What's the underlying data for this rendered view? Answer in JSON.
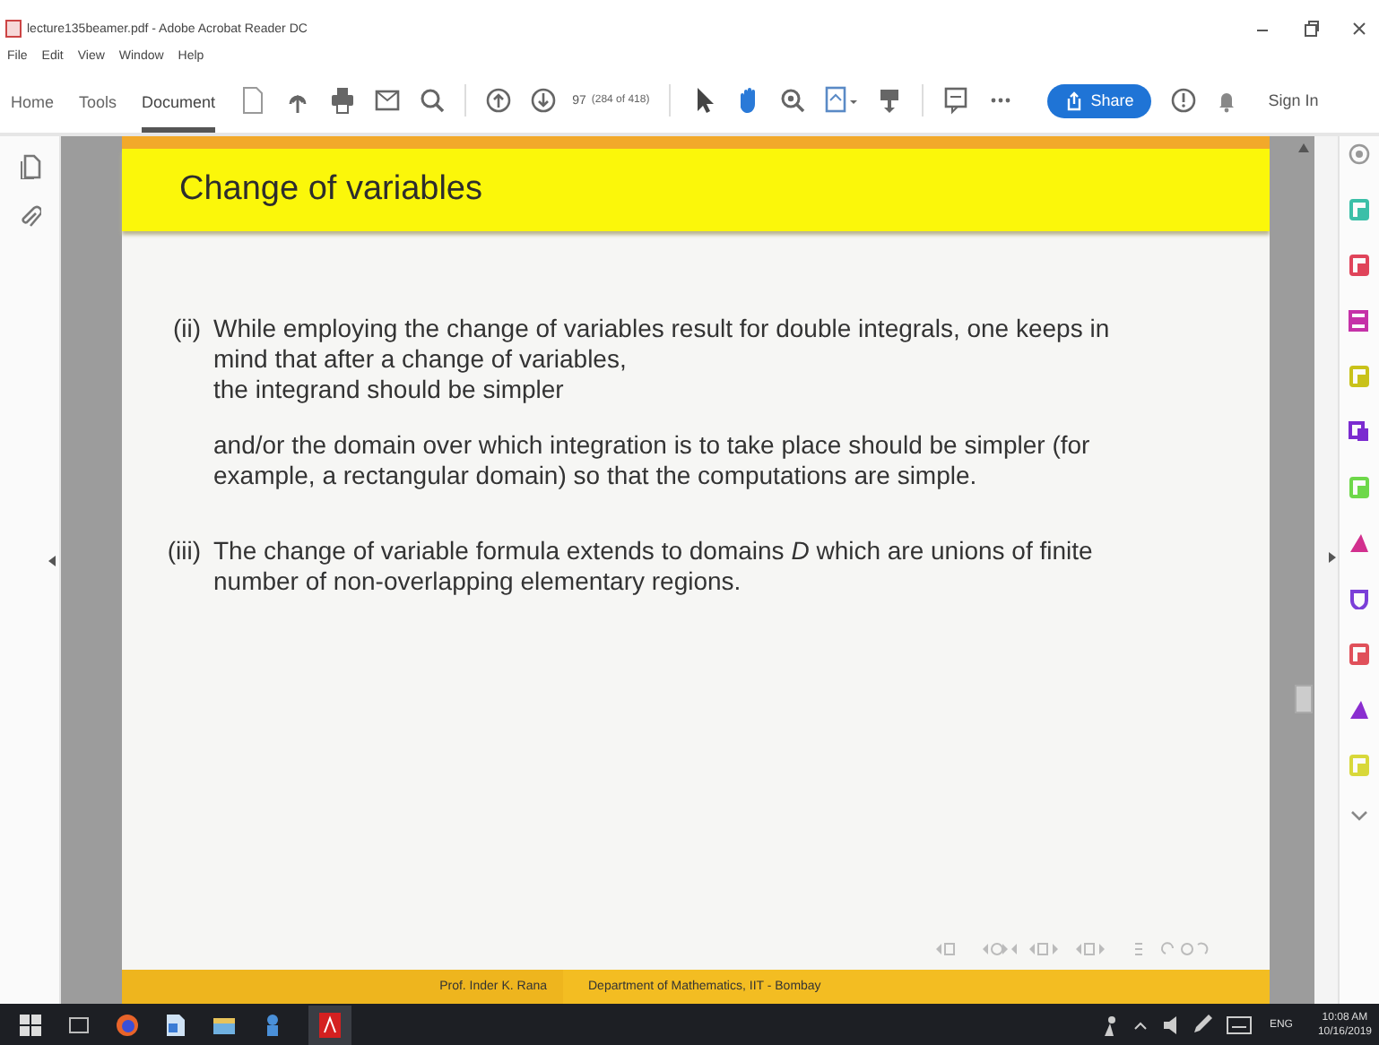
{
  "window": {
    "title": "lecture135beamer.pdf - Adobe Acrobat Reader DC"
  },
  "menu": [
    "File",
    "Edit",
    "View",
    "Window",
    "Help"
  ],
  "tabs": [
    {
      "label": "Home",
      "selected": false
    },
    {
      "label": "Tools",
      "selected": false
    },
    {
      "label": "Document",
      "selected": true
    }
  ],
  "page_field": {
    "value": "97",
    "total": "(284 of 418)"
  },
  "tools": [
    {
      "kind": "pointer",
      "selected": false
    },
    {
      "kind": "hand",
      "selected": true
    }
  ],
  "share_button": "Share",
  "sign_in": "Sign In",
  "slide": {
    "title": "Change of variables",
    "items": [
      {
        "marker": "(ii)",
        "paragraphs": [
          "While employing the change of variables result for double integrals, one keeps in mind that after a change of variables,",
          "the integrand should be simpler",
          "and/or the domain over which integration is to take place should be simpler (for example, a rectangular domain) so that the computations are simple."
        ]
      },
      {
        "marker": "(iii)",
        "paragraphs": [
          "The change of variable formula extends to domains *D* which are unions of finite number of non-overlapping elementary regions."
        ]
      }
    ],
    "footer_author": "Prof. Inder K. Rana",
    "footer_institute": "Department of Mathematics, IIT - Bombay"
  },
  "taskbar": {
    "language": "ENG",
    "time": "10:08 AM",
    "date": "10/16/2019"
  }
}
